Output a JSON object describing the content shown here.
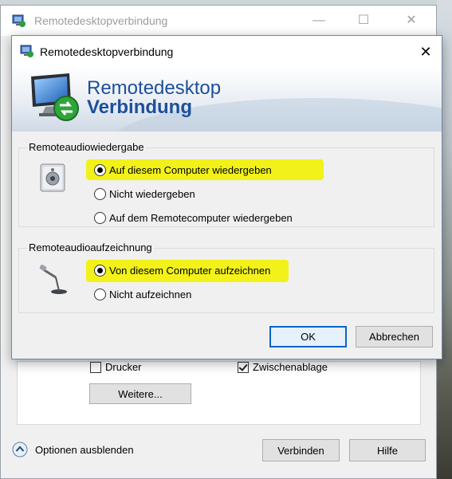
{
  "back_window": {
    "title": "Remotedesktopverbindung",
    "controls": {
      "minimize": "—",
      "maximize": "☐",
      "close": "✕"
    },
    "checkboxes": [
      {
        "label": "Drucker",
        "checked": false
      },
      {
        "label": "Zwischenablage",
        "checked": true
      }
    ],
    "more_button": "Weitere...",
    "options_toggle_label": "Optionen ausblenden",
    "connect_button": "Verbinden",
    "help_button": "Hilfe"
  },
  "dialog": {
    "title": "Remotedesktopverbindung",
    "close_glyph": "✕",
    "banner": {
      "line1": "Remotedesktop",
      "line2": "Verbindung"
    },
    "playback_group": {
      "title": "Remoteaudiowiedergabe",
      "options": [
        {
          "label": "Auf diesem Computer wiedergeben",
          "selected": true,
          "highlighted": true
        },
        {
          "label": "Nicht wiedergeben",
          "selected": false,
          "highlighted": false
        },
        {
          "label": "Auf dem Remotecomputer wiedergeben",
          "selected": false,
          "highlighted": false
        }
      ]
    },
    "recording_group": {
      "title": "Remoteaudioaufzeichnung",
      "options": [
        {
          "label": "Von diesem Computer aufzeichnen",
          "selected": true,
          "highlighted": true
        },
        {
          "label": "Nicht aufzeichnen",
          "selected": false,
          "highlighted": false
        }
      ]
    },
    "ok_button": "OK",
    "cancel_button": "Abbrechen"
  },
  "colors": {
    "accent": "#0a64c9",
    "banner_text": "#1d4f9b",
    "highlight": "#f2f21a"
  }
}
